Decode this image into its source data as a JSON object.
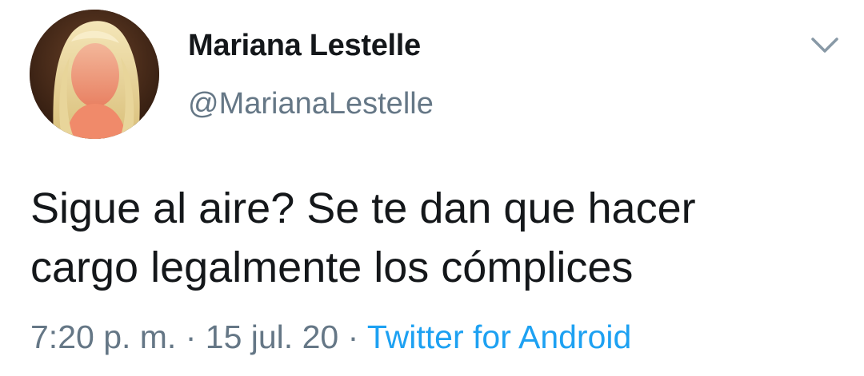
{
  "user": {
    "display_name": "Mariana Lestelle",
    "handle": "@MarianaLestelle",
    "avatar_icon": "profile-photo"
  },
  "tweet": {
    "text_lines": [
      "Sigue al aire? Se te dan que hacer",
      "cargo legalmente los cómplices"
    ],
    "time": "7:20 p. m.",
    "date": "15 jul. 20",
    "source": "Twitter for Android",
    "separator": " · "
  },
  "menu": {
    "icon": "chevron-down-icon"
  },
  "colors": {
    "text": "#14171a",
    "secondary": "#657786",
    "link": "#1da1f2"
  }
}
